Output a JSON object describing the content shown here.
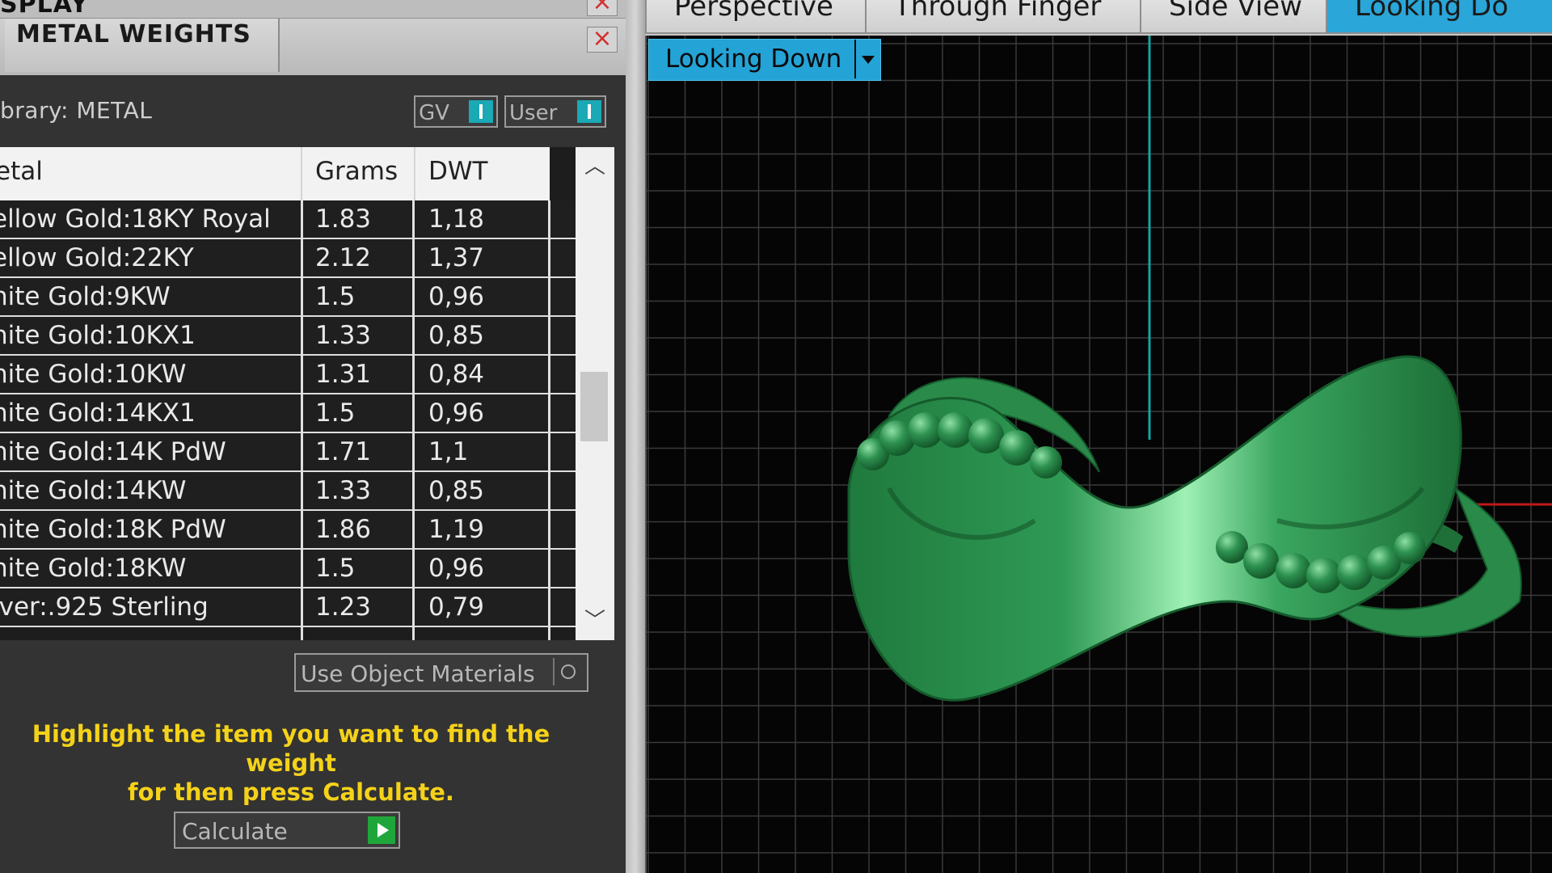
{
  "top_panel": {
    "title": "SPLAY"
  },
  "panel": {
    "title": "METAL WEIGHTS",
    "library_label": "brary: METAL"
  },
  "toggles": {
    "gv": "GV",
    "user": "User"
  },
  "table": {
    "headers": {
      "metal": "etal",
      "grams": "Grams",
      "dwt": "DWT"
    },
    "rows": [
      {
        "metal": "ellow Gold:18KY Royal",
        "grams": "1.83",
        "dwt": "1,18"
      },
      {
        "metal": "ellow Gold:22KY",
        "grams": "2.12",
        "dwt": "1,37"
      },
      {
        "metal": "hite Gold:9KW",
        "grams": "1.5",
        "dwt": "0,96"
      },
      {
        "metal": "hite Gold:10KX1",
        "grams": "1.33",
        "dwt": "0,85"
      },
      {
        "metal": "hite Gold:10KW",
        "grams": "1.31",
        "dwt": "0,84"
      },
      {
        "metal": "hite Gold:14KX1",
        "grams": "1.5",
        "dwt": "0,96"
      },
      {
        "metal": "hite Gold:14K PdW",
        "grams": "1.71",
        "dwt": "1,1"
      },
      {
        "metal": "hite Gold:14KW",
        "grams": "1.33",
        "dwt": "0,85"
      },
      {
        "metal": "hite Gold:18K PdW",
        "grams": "1.86",
        "dwt": "1,19"
      },
      {
        "metal": "hite Gold:18KW",
        "grams": "1.5",
        "dwt": "0,96"
      },
      {
        "metal": "lver:.925 Sterling",
        "grams": "1.23",
        "dwt": "0,79"
      }
    ]
  },
  "buttons": {
    "use_object_materials": "Use Object Materials",
    "calculate": "Calculate"
  },
  "instruction": {
    "line1": "Highlight the item you want to find the weight",
    "line2": "for then press Calculate."
  },
  "viewport": {
    "tabs": [
      "Perspective",
      "Through Finger",
      "Side View",
      "Looking Do"
    ],
    "active_tab": "Looking Do",
    "view_select": "Looking Down"
  },
  "colors": {
    "accent": "#2aa6d8",
    "instruction_text": "#f5d21a",
    "ring_model": "#2f9a55",
    "grid_line": "#3a3a3a",
    "axis_vertical": "#17a3a3",
    "axis_horizontal": "#c01818"
  },
  "icons": {
    "close": "close-icon",
    "toggle": "toggle-switch-icon",
    "scroll_up": "chevron-up-icon",
    "scroll_down": "chevron-down-icon",
    "object_materials": "circle-icon",
    "calculate": "play-icon",
    "dropdown": "dropdown-arrow-icon"
  }
}
